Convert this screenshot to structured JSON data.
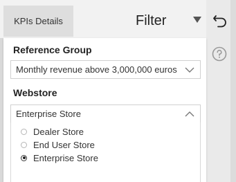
{
  "tab": {
    "label": "KPIs Details"
  },
  "filter": {
    "title": "Filter"
  },
  "reference_group": {
    "label": "Reference Group",
    "selected": "Monthly revenue above 3,000,000 euros"
  },
  "webstore": {
    "label": "Webstore",
    "selected": "Enterprise Store",
    "options": [
      {
        "label": "Dealer Store",
        "checked": false
      },
      {
        "label": "End User Store",
        "checked": false
      },
      {
        "label": "Enterprise Store",
        "checked": true
      }
    ]
  },
  "icons": {
    "caret": "caret-down-icon",
    "undo": "undo-icon",
    "help": "help-icon",
    "chevron_down": "chevron-down-icon",
    "chevron_up": "chevron-up-icon"
  }
}
